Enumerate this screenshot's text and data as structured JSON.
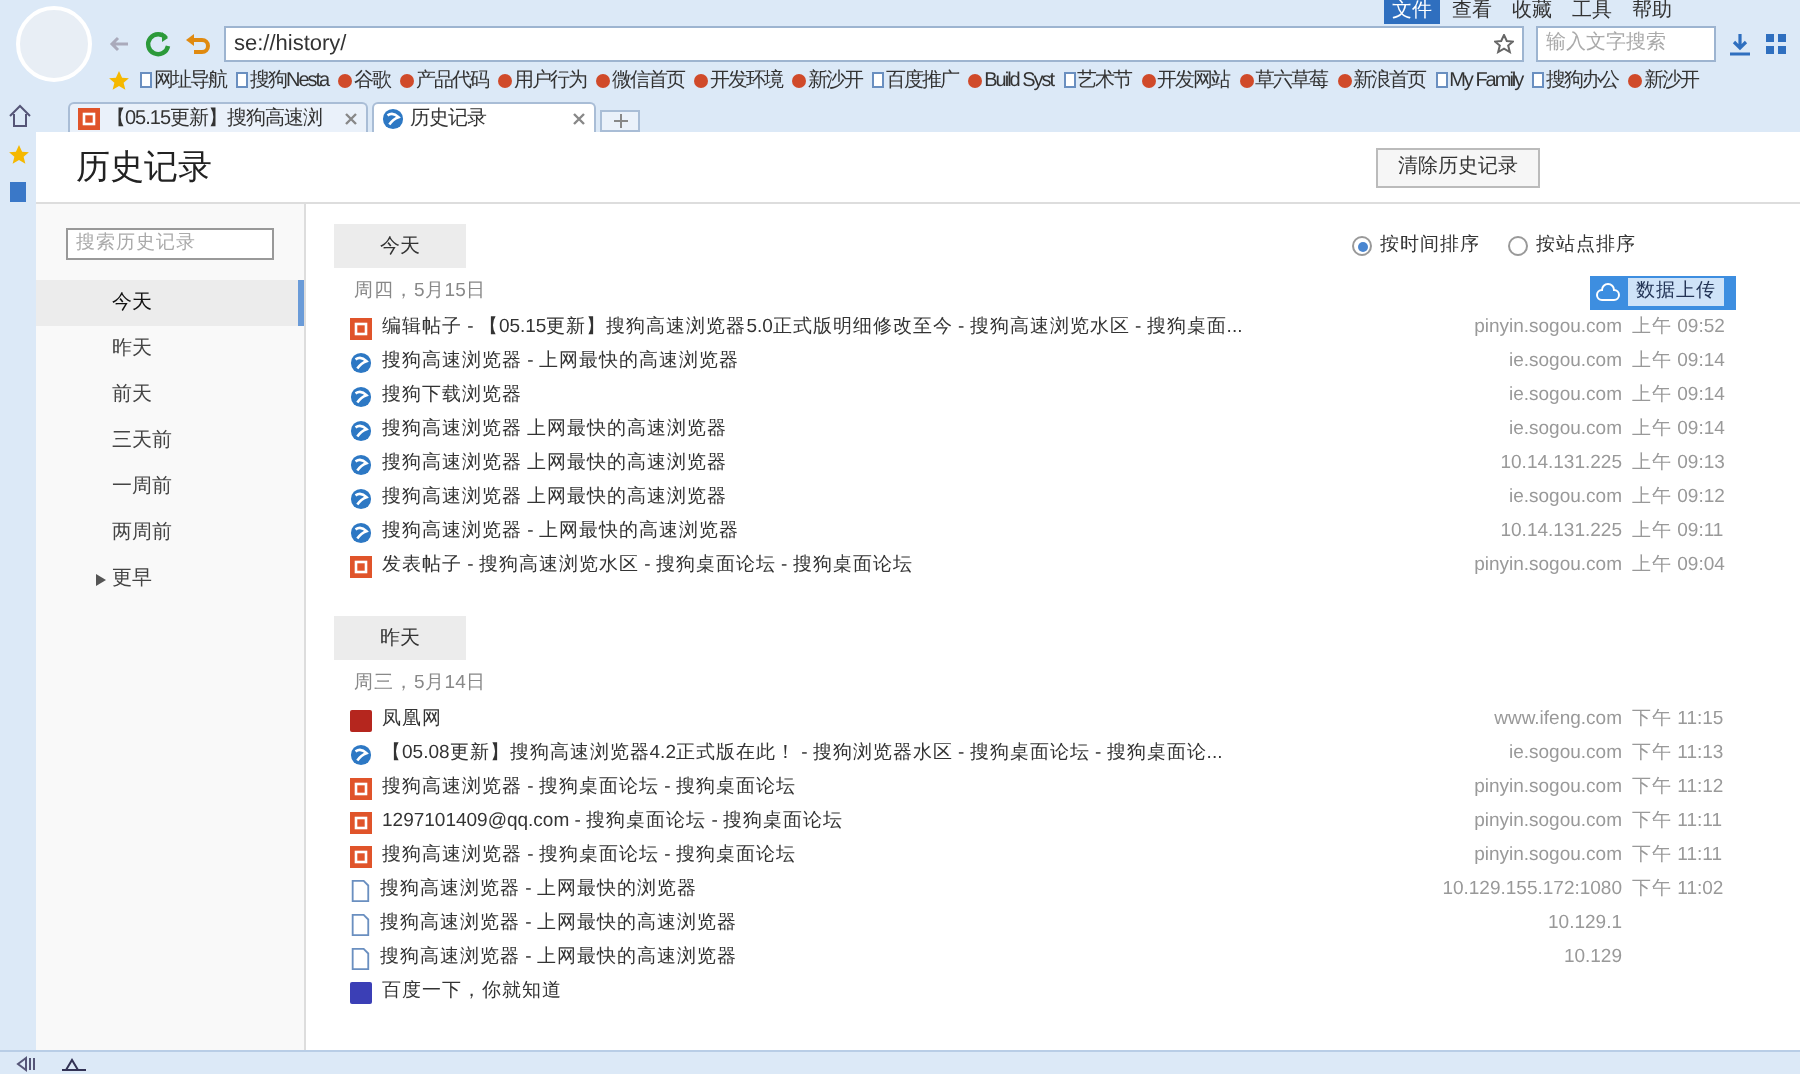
{
  "menu": [
    {
      "label": "文件",
      "selected": true
    },
    {
      "label": "查看",
      "selected": false
    },
    {
      "label": "收藏",
      "selected": false
    },
    {
      "label": "工具",
      "selected": false
    },
    {
      "label": "帮助",
      "selected": false
    }
  ],
  "address": "se://history/",
  "search_placeholder": "输入文字搜索",
  "bookmarks": [
    {
      "label": "网址导航",
      "kind": "folder"
    },
    {
      "label": "搜狗Nesta",
      "kind": "folder"
    },
    {
      "label": "谷歌",
      "kind": "site"
    },
    {
      "label": "产品代码",
      "kind": "site"
    },
    {
      "label": "用户行为",
      "kind": "site"
    },
    {
      "label": "微信首页",
      "kind": "site"
    },
    {
      "label": "开发环境",
      "kind": "site"
    },
    {
      "label": "新沙开",
      "kind": "site"
    },
    {
      "label": "百度推广",
      "kind": "folder"
    },
    {
      "label": "Build Syst",
      "kind": "site"
    },
    {
      "label": "艺术节",
      "kind": "folder"
    },
    {
      "label": "开发网站",
      "kind": "site"
    },
    {
      "label": "草六草莓",
      "kind": "site"
    },
    {
      "label": "新浪首页",
      "kind": "site"
    },
    {
      "label": "My Family",
      "kind": "folder"
    },
    {
      "label": "搜狗办公",
      "kind": "folder"
    },
    {
      "label": "新沙开",
      "kind": "site"
    }
  ],
  "tabs": [
    {
      "label": "【05.15更新】搜狗高速浏",
      "selected": false
    },
    {
      "label": "历史记录",
      "selected": true
    }
  ],
  "page": {
    "title": "历史记录",
    "clear_button": "清除历史记录"
  },
  "sidebar": {
    "search_placeholder": "搜索历史记录",
    "items": [
      {
        "label": "今天",
        "selected": true
      },
      {
        "label": "昨天",
        "selected": false
      },
      {
        "label": "前天",
        "selected": false
      },
      {
        "label": "三天前",
        "selected": false
      },
      {
        "label": "一周前",
        "selected": false
      },
      {
        "label": "两周前",
        "selected": false
      },
      {
        "label": "更早",
        "selected": false,
        "expanded": false
      }
    ]
  },
  "sort": [
    {
      "label": "按时间排序",
      "selected": true
    },
    {
      "label": "按站点排序",
      "selected": false
    }
  ],
  "upload_button": "数据上传",
  "sections": [
    {
      "label": "今天",
      "date": "周四，5月15日",
      "rows": [
        {
          "kind": "sogou",
          "title": "编辑帖子 - 【05.15更新】搜狗高速浏览器5.0正式版明细修改至今 - 搜狗高速浏览水区 - 搜狗桌面...",
          "domain": "pinyin.sogou.com",
          "time": "上午 09:52"
        },
        {
          "kind": "browser",
          "title": "搜狗高速浏览器 - 上网最快的高速浏览器",
          "domain": "ie.sogou.com",
          "time": "上午 09:14"
        },
        {
          "kind": "browser",
          "title": "搜狗下载浏览器",
          "domain": "ie.sogou.com",
          "time": "上午 09:14"
        },
        {
          "kind": "browser",
          "title": "搜狗高速浏览器 上网最快的高速浏览器",
          "domain": "ie.sogou.com",
          "time": "上午 09:14"
        },
        {
          "kind": "browser",
          "title": "搜狗高速浏览器 上网最快的高速浏览器",
          "domain": "10.14.131.225",
          "time": "上午 09:13"
        },
        {
          "kind": "browser",
          "title": "搜狗高速浏览器 上网最快的高速浏览器",
          "domain": "ie.sogou.com",
          "time": "上午 09:12"
        },
        {
          "kind": "browser",
          "title": "搜狗高速浏览器 - 上网最快的高速浏览器",
          "domain": "10.14.131.225",
          "time": "上午 09:11"
        },
        {
          "kind": "sogou",
          "title": "发表帖子 - 搜狗高速浏览水区 - 搜狗桌面论坛 - 搜狗桌面论坛",
          "domain": "pinyin.sogou.com",
          "time": "上午 09:04"
        }
      ]
    },
    {
      "label": "昨天",
      "date": "周三，5月14日",
      "rows": [
        {
          "kind": "ifeng",
          "title": "凤凰网",
          "domain": "www.ifeng.com",
          "time": "下午 11:15"
        },
        {
          "kind": "browser",
          "title": "【05.08更新】搜狗高速浏览器4.2正式版在此！ - 搜狗浏览器水区 - 搜狗桌面论坛 - 搜狗桌面论...",
          "domain": "ie.sogou.com",
          "time": "下午 11:13"
        },
        {
          "kind": "sogou",
          "title": "搜狗高速浏览器 - 搜狗桌面论坛 - 搜狗桌面论坛",
          "domain": "pinyin.sogou.com",
          "time": "下午 11:12"
        },
        {
          "kind": "sogou",
          "title": "1297101409@qq.com - 搜狗桌面论坛 - 搜狗桌面论坛",
          "domain": "pinyin.sogou.com",
          "time": "下午 11:11"
        },
        {
          "kind": "sogou",
          "title": "搜狗高速浏览器 - 搜狗桌面论坛 - 搜狗桌面论坛",
          "domain": "pinyin.sogou.com",
          "time": "下午 11:11"
        },
        {
          "kind": "page",
          "title": "搜狗高速浏览器 - 上网最快的浏览器",
          "domain": "10.129.155.172:1080",
          "time": "下午 11:02"
        },
        {
          "kind": "page",
          "title": "搜狗高速浏览器 - 上网最快的高速浏览器",
          "domain": "10.129.1"
        },
        {
          "kind": "page",
          "title": "搜狗高速浏览器 - 上网最快的高速浏览器",
          "domain": "10.129"
        },
        {
          "kind": "baidu",
          "title": "百度一下，你就知道"
        }
      ]
    }
  ]
}
